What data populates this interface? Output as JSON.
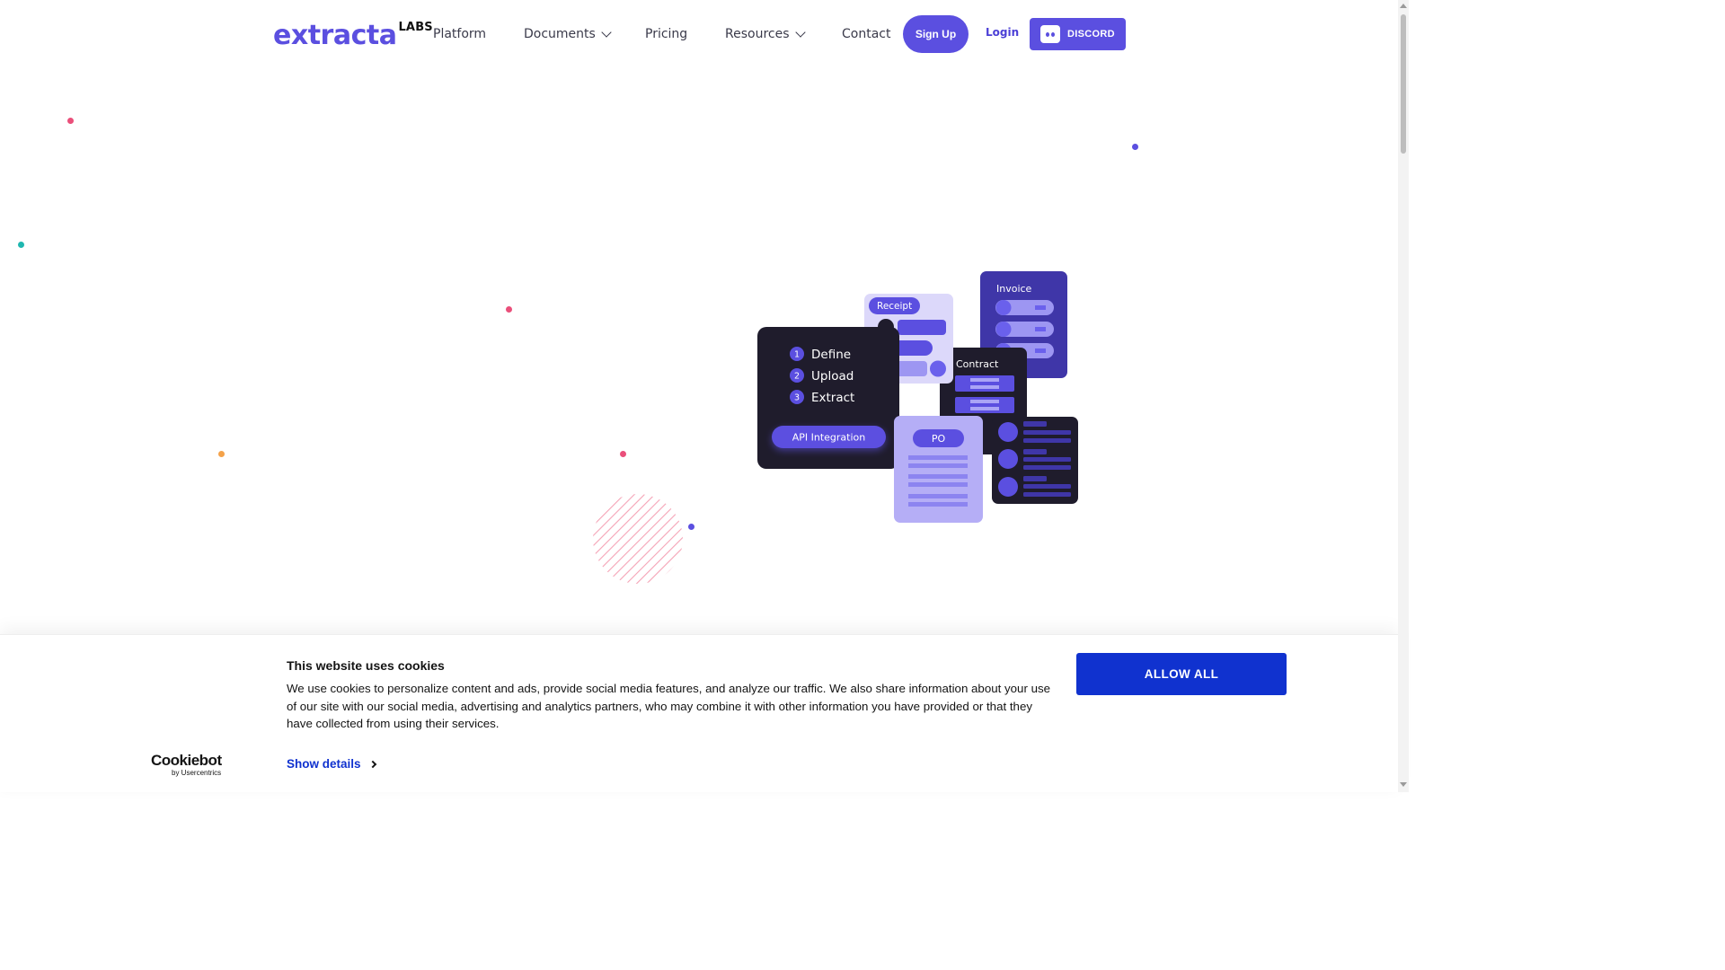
{
  "brand": {
    "name": "extracta",
    "suffix": "LABS"
  },
  "nav": {
    "links": [
      {
        "label": "Platform",
        "dropdown": false
      },
      {
        "label": "Documents",
        "dropdown": true
      },
      {
        "label": "Pricing",
        "dropdown": false
      },
      {
        "label": "Resources",
        "dropdown": true
      },
      {
        "label": "Contact",
        "dropdown": false
      }
    ],
    "signup_label": "Sign Up",
    "login_label": "Login",
    "discord_label": "DISCORD",
    "discord_icon": "discord-icon"
  },
  "hero": {
    "steps": [
      {
        "num": "1",
        "label": "Define"
      },
      {
        "num": "2",
        "label": "Upload"
      },
      {
        "num": "3",
        "label": "Extract"
      }
    ],
    "api_label": "API Integration",
    "cards": {
      "receipt": "Receipt",
      "invoice": "Invoice",
      "contract": "Contract",
      "po": "PO"
    }
  },
  "colors": {
    "accent": "#5b4fe0",
    "dark_card": "#1f1c2c",
    "light_card": "#dcd8fa",
    "cookie_button": "#1032cf"
  },
  "cookie": {
    "title": "This website uses cookies",
    "text": "We use cookies to personalize content and ads, provide social media features, and analyze our traffic. We also share information about your use of our site with our social media, advertising and analytics partners, who may combine it with other information you have provided or that they have collected from using their services.",
    "show_details": "Show details",
    "allow_all": "ALLOW ALL",
    "provider": "Cookiebot",
    "provider_sub": "by Usercentrics"
  }
}
